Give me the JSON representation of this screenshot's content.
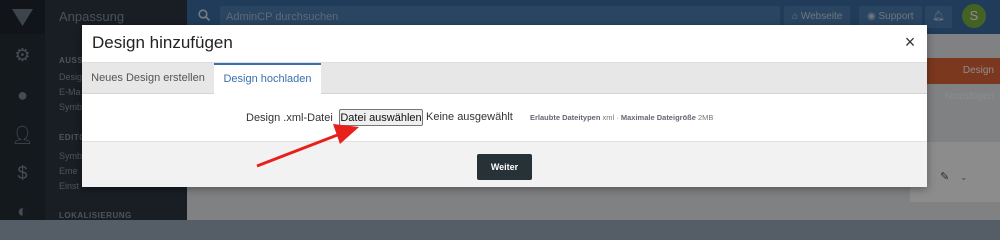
{
  "app": {
    "sidenav_title": "Anpassung",
    "search_placeholder": "AdminCP durchsuchen",
    "website_label": "Webseite",
    "support_label": "Support",
    "avatar_letter": "S",
    "sections": [
      "AUSS",
      "EDITO",
      "LOKALISIERUNG"
    ],
    "items": [
      "Desig",
      "E-Ma",
      "Symb",
      "Symb",
      "Eme",
      "Einst"
    ],
    "add_design_button": "Design hinzufügen"
  },
  "modal": {
    "title": "Design hinzufügen",
    "close_label": "×",
    "tabs": [
      {
        "label": "Neues Design erstellen",
        "active": false
      },
      {
        "label": "Design hochladen",
        "active": true
      }
    ],
    "field_label": "Design .xml-Datei",
    "file_button": "Datei auswählen",
    "file_status": "Keine ausgewählt",
    "hint_types_label": "Erlaubte Dateitypen",
    "hint_types_value": "xml",
    "hint_size_label": "Maximale Dateigröße",
    "hint_size_value": "2MB",
    "submit_button": "Weiter"
  },
  "colors": {
    "accent": "#3a6fb0",
    "arrow": "#e8201c",
    "submit": "#263238"
  }
}
